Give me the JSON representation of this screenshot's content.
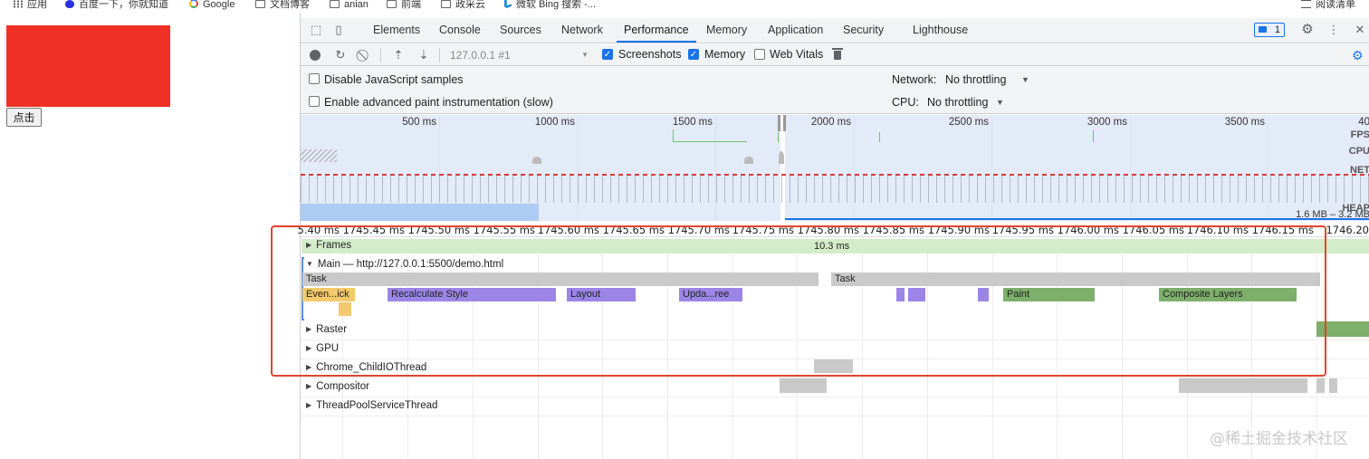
{
  "bookmarks": [
    {
      "label": "应用",
      "icon": "apps-grid-icon"
    },
    {
      "label": "百度一下，你就知道",
      "icon": "baidu-icon"
    },
    {
      "label": "Google",
      "icon": "google-icon"
    },
    {
      "label": "文档博客",
      "icon": "folder-icon"
    },
    {
      "label": "anian",
      "icon": "folder-icon"
    },
    {
      "label": "前端",
      "icon": "folder-icon"
    },
    {
      "label": "政采云",
      "icon": "folder-icon"
    },
    {
      "label": "微软 Bing 搜索 -...",
      "icon": "bing-icon"
    }
  ],
  "reading_list": {
    "label": "阅读清单",
    "icon": "reading-list-icon"
  },
  "page": {
    "button_label": "点击",
    "box_color": "#ee3124"
  },
  "devtools": {
    "tabs": [
      "Elements",
      "Console",
      "Sources",
      "Network",
      "Performance",
      "Memory",
      "Application",
      "Security",
      "Lighthouse"
    ],
    "active_tab": "Performance",
    "issues_count": "1",
    "toolbar": {
      "profile": "127.0.0.1 #1",
      "screenshots": {
        "label": "Screenshots",
        "checked": true
      },
      "memory": {
        "label": "Memory",
        "checked": true
      },
      "web_vitals": {
        "label": "Web Vitals",
        "checked": false
      }
    },
    "settings": {
      "disable_js_samples": "Disable JavaScript samples",
      "advanced_paint": "Enable advanced paint instrumentation (slow)",
      "network_label": "Network:",
      "network_value": "No throttling",
      "cpu_label": "CPU:",
      "cpu_value": "No throttling"
    },
    "overview": {
      "ticks": [
        "500 ms",
        "1000 ms",
        "1500 ms",
        "2000 ms",
        "2500 ms",
        "3000 ms",
        "3500 ms",
        "40"
      ],
      "rows": [
        "FPS",
        "CPU",
        "NET",
        "HEAP"
      ],
      "heap_range": "1.6 MB – 3.2 MB"
    },
    "flame": {
      "ruler": [
        "5.40 ms",
        "1745.45 ms",
        "1745.50 ms",
        "1745.55 ms",
        "1745.60 ms",
        "1745.65 ms",
        "1745.70 ms",
        "1745.75 ms",
        "1745.80 ms",
        "1745.85 ms",
        "1745.90 ms",
        "1745.95 ms",
        "1746.00 ms",
        "1746.05 ms",
        "1746.10 ms",
        "1746.15 ms",
        "1746.20"
      ],
      "frames_label": "Frames",
      "frame_duration": "10.3 ms",
      "main_label": "Main — http://127.0.0.1:5500/demo.html",
      "task_label": "Task",
      "events": {
        "event_click": "Even...ick",
        "recalc": "Recalculate Style",
        "layout": "Layout",
        "update": "Upda...ree",
        "paint": "Paint",
        "composite": "Composite Layers"
      },
      "tracks": [
        "Raster",
        "GPU",
        "Chrome_ChildIOThread",
        "Compositor",
        "ThreadPoolServiceThread"
      ]
    }
  },
  "watermark": "@稀土掘金技术社区"
}
